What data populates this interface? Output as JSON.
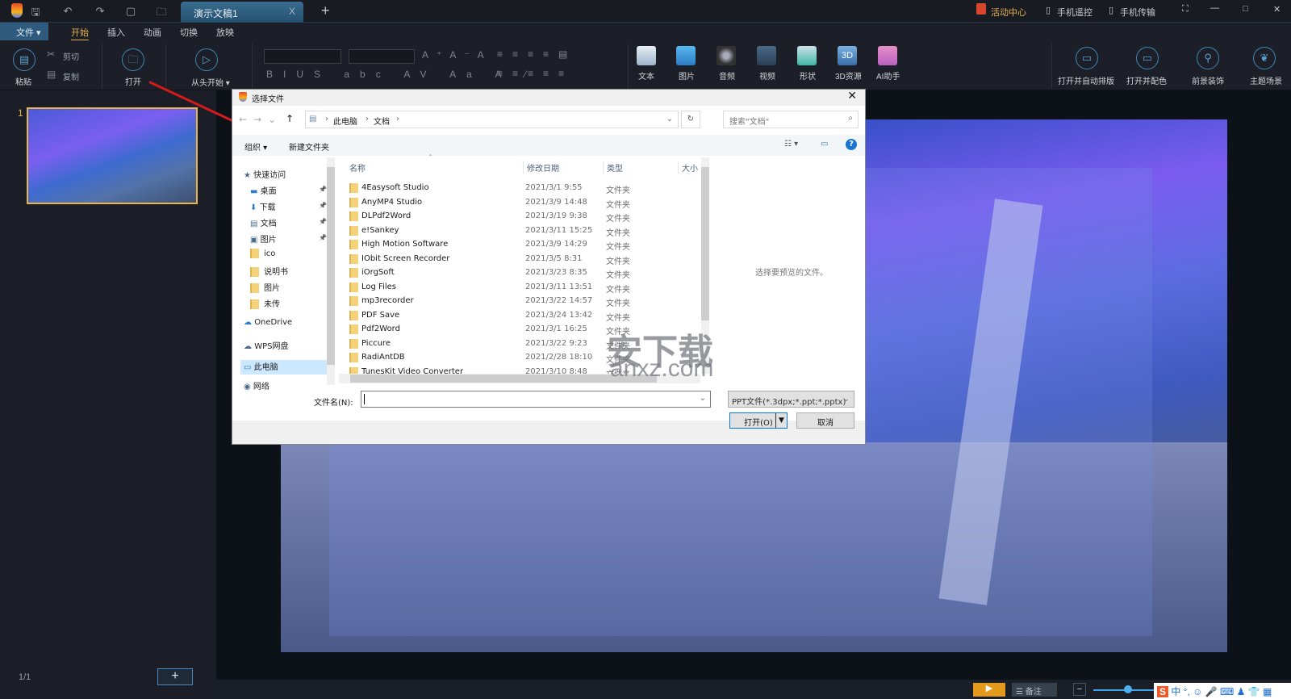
{
  "titlebar": {
    "tab_title": "演示文稿1",
    "close": "X",
    "add": "+",
    "activity": "活动中心",
    "remote": "手机遥控",
    "transfer": "手机传输"
  },
  "menu": {
    "file": "文件",
    "items": [
      "开始",
      "插入",
      "动画",
      "切换",
      "放映"
    ]
  },
  "ribbon": {
    "paste": "粘贴",
    "cut": "剪切",
    "copy": "复制",
    "open": "打开",
    "from_start": "从头开始",
    "insert": [
      "文本",
      "图片",
      "音频",
      "视频",
      "形状",
      "3D资源",
      "AI助手"
    ],
    "right": [
      "打开并自动排版",
      "打开并配色",
      "前景装饰",
      "主题场景"
    ]
  },
  "slides": {
    "number": "1",
    "counter": "1/1",
    "add": "+"
  },
  "status": {
    "notes": "备注"
  },
  "dialog": {
    "title": "选择文件",
    "breadcrumb": [
      "此电脑",
      "文档"
    ],
    "search_placeholder": "搜索\"文档\"",
    "organize": "组织",
    "new_folder": "新建文件夹",
    "nav": [
      {
        "label": "快速访问",
        "pin": false
      },
      {
        "label": "桌面",
        "pin": true
      },
      {
        "label": "下载",
        "pin": true
      },
      {
        "label": "文档",
        "pin": true
      },
      {
        "label": "图片",
        "pin": true
      },
      {
        "label": "ico",
        "pin": false
      },
      {
        "label": "说明书",
        "pin": false
      },
      {
        "label": "图片",
        "pin": false
      },
      {
        "label": "未传",
        "pin": false
      },
      {
        "label": "OneDrive",
        "pin": false
      },
      {
        "label": "WPS网盘",
        "pin": false
      },
      {
        "label": "此电脑",
        "pin": false
      },
      {
        "label": "网络",
        "pin": false
      }
    ],
    "columns": [
      "名称",
      "修改日期",
      "类型",
      "大小"
    ],
    "files": [
      {
        "name": "4Easysoft Studio",
        "date": "2021/3/1 9:55",
        "type": "文件夹"
      },
      {
        "name": "AnyMP4 Studio",
        "date": "2021/3/9 14:48",
        "type": "文件夹"
      },
      {
        "name": "DLPdf2Word",
        "date": "2021/3/19 9:38",
        "type": "文件夹"
      },
      {
        "name": "e!Sankey",
        "date": "2021/3/11 15:25",
        "type": "文件夹"
      },
      {
        "name": "High Motion Software",
        "date": "2021/3/9 14:29",
        "type": "文件夹"
      },
      {
        "name": "IObit Screen Recorder",
        "date": "2021/3/5 8:31",
        "type": "文件夹"
      },
      {
        "name": "iOrgSoft",
        "date": "2021/3/23 8:35",
        "type": "文件夹"
      },
      {
        "name": "Log Files",
        "date": "2021/3/11 13:51",
        "type": "文件夹"
      },
      {
        "name": "mp3recorder",
        "date": "2021/3/22 14:57",
        "type": "文件夹"
      },
      {
        "name": "PDF Save",
        "date": "2021/3/24 13:42",
        "type": "文件夹"
      },
      {
        "name": "Pdf2Word",
        "date": "2021/3/1 16:25",
        "type": "文件夹"
      },
      {
        "name": "Piccure",
        "date": "2021/3/22 9:23",
        "type": "文件夹"
      },
      {
        "name": "RadiAntDB",
        "date": "2021/2/28 18:10",
        "type": "文件夹"
      },
      {
        "name": "TunesKit Video Converter",
        "date": "2021/3/10 8:48",
        "type": "文件夹"
      }
    ],
    "preview_text": "选择要预览的文件。",
    "filename_label": "文件名(N):",
    "filename_value": "",
    "filter": "PPT文件(*.3dpx;*.ppt;*.pptx)",
    "open": "打开(O)",
    "cancel": "取消"
  },
  "watermark": {
    "text": "安下载",
    "url": "anxz.com"
  },
  "colors": {
    "accent": "#e6b24a",
    "brand_blue": "#2e5b7d",
    "dialog_primary_border": "#0078d7"
  }
}
